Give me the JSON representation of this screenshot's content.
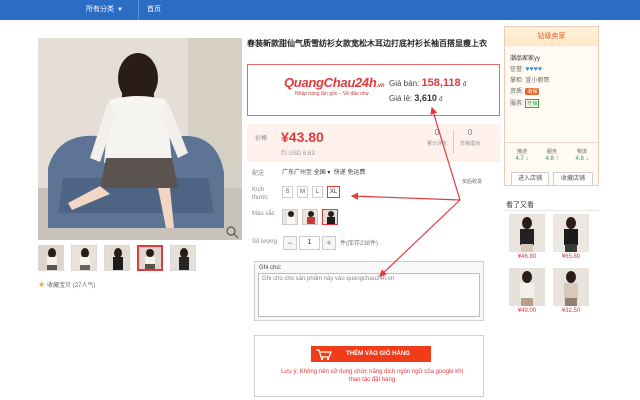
{
  "nav": {
    "all_categories": "所有分类",
    "home": "首页"
  },
  "title": "春装新款甜仙气质雪纺衫女款宽松木耳边打底衬衫长袖百搭显瘦上衣",
  "quangchau": {
    "brand": "QuangChau24h",
    "brand_tld": ".vn",
    "tagline": "Nhập hàng tận gốc – Về đâu như",
    "wholesale_label": "Giá bán:",
    "wholesale_price": "158,118",
    "retail_label": "Giá lẻ:",
    "retail_price": "3,610",
    "currency": "đ"
  },
  "price": {
    "label": "价格",
    "value": "¥43.80",
    "usd": "约 USD 6.63",
    "stats": [
      {
        "num": "0",
        "label": "累计评论"
      },
      {
        "num": "0",
        "label": "交易成功"
      }
    ]
  },
  "shipping": {
    "label": "配送",
    "origin": "广东广州至",
    "dest": "全国",
    "method": "快递 免运费",
    "more": "买后收货"
  },
  "size": {
    "label": "Kích thước",
    "options": [
      "S",
      "M",
      "L",
      "XL"
    ],
    "selected": "XL"
  },
  "color": {
    "label": "Màu sắc"
  },
  "quantity": {
    "label": "Số lượng",
    "minus": "−",
    "value": "1",
    "plus": "+",
    "unit": "件(库存238件)"
  },
  "note": {
    "label": "Ghi chú:",
    "placeholder": "Ghi chú cho sản phẩm này vào quangchau24h.vn"
  },
  "cart": {
    "button": "THÊM VÀO GIỎ HÀNG",
    "warning": "Lưu ý: Không nên sử dụng chức năng dịch ngôn ngữ của google khi thao tác đặt hàng"
  },
  "favorite": "收藏宝贝 (27人气)",
  "seller": {
    "header": "钻级卖家",
    "name": "潮品家家yy",
    "credit_label": "信誉:",
    "contact_label": "掌柜:",
    "contact_name": "宣小丽哥",
    "quality_label": "资质:",
    "quality_badge": "消保",
    "service_label": "服务:",
    "service_badge": "旺铺",
    "scores": [
      {
        "label": "描述",
        "value": "4.7",
        "trend": "↓"
      },
      {
        "label": "服务",
        "value": "4.8",
        "trend": "↑"
      },
      {
        "label": "物流",
        "value": "4.8",
        "trend": "↓"
      }
    ],
    "enter_store": "进入店铺",
    "save_store": "收藏店铺"
  },
  "recommended": {
    "title": "看了又看",
    "items": [
      {
        "price": "¥46.80"
      },
      {
        "price": "¥85.80"
      },
      {
        "price": "¥49.00"
      },
      {
        "price": "¥32.50"
      }
    ]
  },
  "colors": {
    "accent": "#e4393c",
    "nav": "#2b6cc4",
    "cart": "#f03c1a"
  }
}
